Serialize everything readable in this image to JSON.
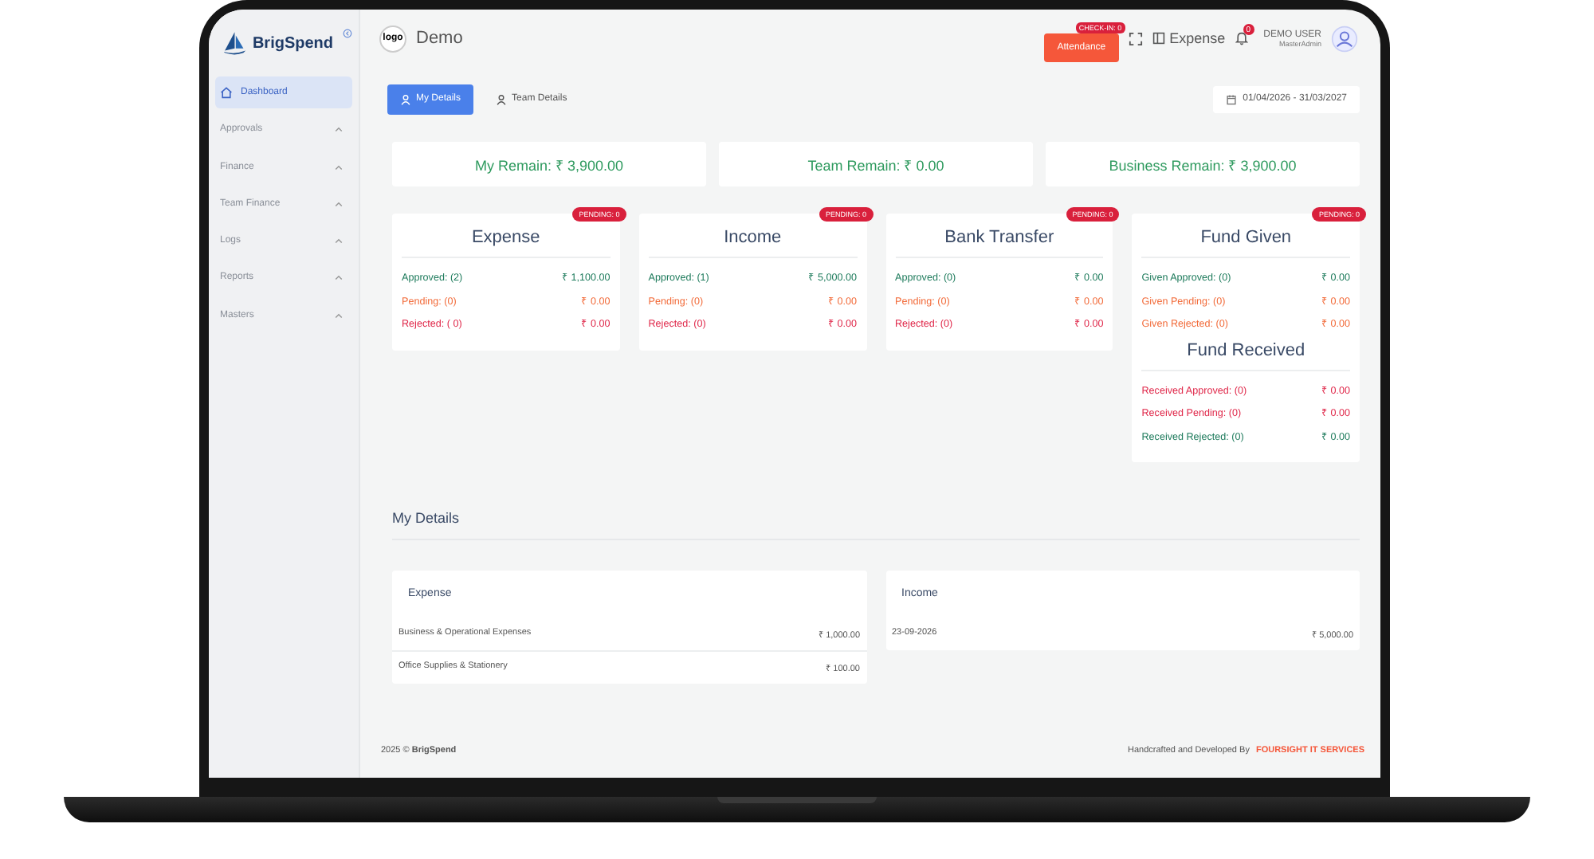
{
  "brand": {
    "name": "BrigSpend"
  },
  "sidebar": {
    "items": [
      {
        "label": "Dashboard",
        "kind": "link",
        "selected": true
      },
      {
        "label": "Approvals",
        "kind": "group",
        "selected": false
      },
      {
        "label": "Finance",
        "kind": "group",
        "selected": false
      },
      {
        "label": "Team Finance",
        "kind": "group",
        "selected": false
      },
      {
        "label": "Logs",
        "kind": "group",
        "selected": false
      },
      {
        "label": "Reports",
        "kind": "group",
        "selected": false
      },
      {
        "label": "Masters",
        "kind": "group",
        "selected": false
      }
    ]
  },
  "header": {
    "org_logo": "logo",
    "org_name": "Demo",
    "attendance": {
      "label": "Attendance",
      "badge": "CHECK-IN: 0"
    },
    "module": "Expense",
    "notifications": "0",
    "user": {
      "name": "DEMO USER",
      "role": "MasterAdmin"
    }
  },
  "tabs": [
    {
      "label": "My Details",
      "selected": true
    },
    {
      "label": "Team Details",
      "selected": false
    }
  ],
  "date_range": "01/04/2026 - 31/03/2027",
  "remains": [
    "My Remain: ₹ 3,900.00",
    "Team Remain: ₹ 0.00",
    "Business Remain: ₹ 3,900.00"
  ],
  "summary_cards": [
    {
      "title": "Expense",
      "badge": "PENDING: 0",
      "sections": [
        {
          "rows": [
            {
              "label": "Approved: (2)",
              "amount": "₹ 1,100.00",
              "color": "#1e7b5c"
            },
            {
              "label": "Pending: (0)",
              "amount": "₹ 0.00",
              "color": "#f26b3a"
            },
            {
              "label": "Rejected: ( 0)",
              "amount": "₹ 0.00",
              "color": "#e0284a"
            }
          ]
        }
      ]
    },
    {
      "title": "Income",
      "badge": "PENDING: 0",
      "sections": [
        {
          "rows": [
            {
              "label": "Approved: (1)",
              "amount": "₹ 5,000.00",
              "color": "#1e7b5c"
            },
            {
              "label": "Pending: (0)",
              "amount": "₹ 0.00",
              "color": "#f26b3a"
            },
            {
              "label": "Rejected: (0)",
              "amount": "₹ 0.00",
              "color": "#e0284a"
            }
          ]
        }
      ]
    },
    {
      "title": "Bank Transfer",
      "badge": "PENDING: 0",
      "sections": [
        {
          "rows": [
            {
              "label": "Approved: (0)",
              "amount": "₹ 0.00",
              "color": "#1e7b5c"
            },
            {
              "label": "Pending: (0)",
              "amount": "₹ 0.00",
              "color": "#f26b3a"
            },
            {
              "label": "Rejected: (0)",
              "amount": "₹ 0.00",
              "color": "#e0284a"
            }
          ]
        }
      ]
    },
    {
      "title": "Fund Given",
      "badge": "PENDING: 0",
      "sections": [
        {
          "rows": [
            {
              "label": "Given Approved: (0)",
              "amount": "₹ 0.00",
              "color": "#1e7b5c"
            },
            {
              "label": "Given Pending: (0)",
              "amount": "₹ 0.00",
              "color": "#f26b3a"
            },
            {
              "label": "Given Rejected: (0)",
              "amount": "₹ 0.00",
              "color": "#f26b3a"
            }
          ]
        },
        {
          "title": "Fund Received",
          "rows": [
            {
              "label": "Received Approved: (0)",
              "amount": "₹ 0.00",
              "color": "#e0284a"
            },
            {
              "label": "Received Pending: (0)",
              "amount": "₹ 0.00",
              "color": "#e0284a"
            },
            {
              "label": "Received Rejected: (0)",
              "amount": "₹ 0.00",
              "color": "#1e7b5c"
            }
          ]
        }
      ]
    }
  ],
  "details": {
    "title": "My Details",
    "panels": [
      {
        "title": "Expense",
        "rows": [
          {
            "label": "Business & Operational Expenses",
            "amount": "₹ 1,000.00"
          },
          {
            "label": "Office Supplies & Stationery",
            "amount": "₹ 100.00"
          }
        ]
      },
      {
        "title": "Income",
        "rows": [
          {
            "label": "23-09-2026",
            "amount": "₹ 5,000.00"
          }
        ]
      }
    ]
  },
  "footer": {
    "copyright": "2025 © **BrigSpend**",
    "credit": "Handcrafted and Developed By",
    "company": "FOURSIGHT IT SERVICES"
  }
}
